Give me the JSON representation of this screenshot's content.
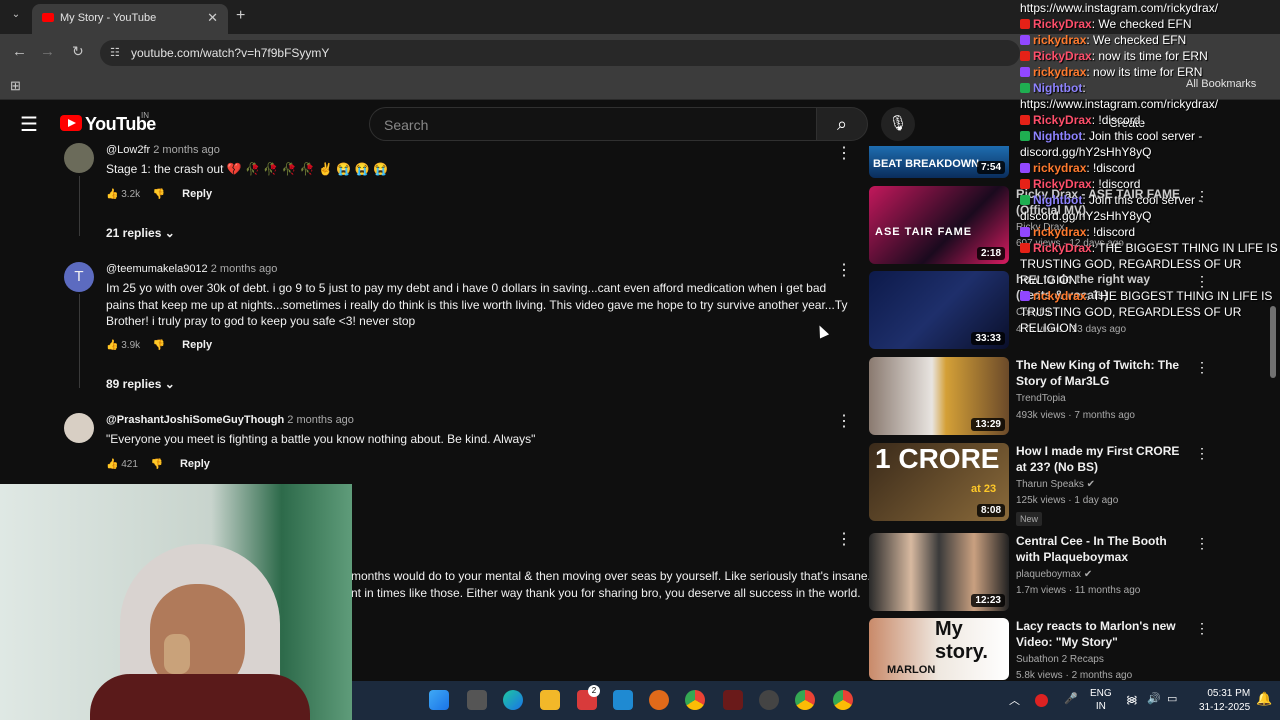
{
  "browser": {
    "tab_title": "My Story - YouTube",
    "url": "youtube.com/watch?v=h7f9bFSyymY",
    "all_bookmarks": "All Bookmarks",
    "new_tab": "+",
    "close": "✕"
  },
  "header": {
    "logo_word": "YouTube",
    "country": "IN",
    "search_placeholder": "Search",
    "create_label": "Create"
  },
  "comments": [
    {
      "author": "@Low2fr",
      "age": "2 months ago",
      "text": "Stage 1: the crash out 💔 🥀 🥀 🥀 🥀 ✌️ 😭 😭 😭",
      "likes": "3.2k",
      "reply": "Reply",
      "replies": "21 replies"
    },
    {
      "author": "@teemumakela9012",
      "age": "2 months ago",
      "avatar_letter": "T",
      "text": "Im 25 yo with over 30k of debt. i go 9 to 5 just to pay my debt and i have 0 dollars in saving...cant even afford medication when i get bad pains that keep me up at nights...sometimes i really do think is this live worth living. This video gave me hope to try survive another year...Ty Brother! i truly pray to god to keep you safe <3! never stop",
      "likes": "3.9k",
      "reply": "Reply",
      "replies": "89 replies"
    },
    {
      "author": "@PrashantJoshiSomeGuyThough",
      "age": "2 months ago",
      "text": "\"Everyone you meet is fighting a battle you know nothing about. Be kind. Always\"",
      "likes": "421",
      "reply": "Reply"
    },
    {
      "text_line1": "months would do to your mental & then moving over seas by yourself. Like seriously that's insane.",
      "text_line2": "nt in times like those. Either way thank you for sharing bro, you deserve all success in the world."
    }
  ],
  "sidebar": [
    {
      "title": "",
      "duration": "7:54",
      "thumb_text": "BEAT BREAKDOWN"
    },
    {
      "title": "Ricky Drax - ASE TAIR FAME (Official MV)",
      "channel": "Ricky Drax",
      "meta": "607 views · 12 days ago",
      "duration": "2:18",
      "thumb_text": "ASE TAIR FAME"
    },
    {
      "title": "how to do the right way (beats & vocals)",
      "channel": "Codyfel",
      "meta": "4.7k views · 13 days ago",
      "duration": "33:33"
    },
    {
      "title": "The New King of Twitch: The Story of Mar3LG",
      "channel": "TrendTopia",
      "meta": "493k views · 7 months ago",
      "duration": "13:29"
    },
    {
      "title": "How I made my First CRORE at 23? (No BS)",
      "channel": "Tharun Speaks",
      "meta": "125k views · 1 day ago",
      "duration": "8:08",
      "badge": "New",
      "thumb_text": "1 CRORE",
      "thumb_sub": "at 23"
    },
    {
      "title": "Central Cee - In The Booth with Plaqueboymax",
      "channel": "plaqueboymax",
      "meta": "1.7m views · 11 months ago",
      "duration": "12:23"
    },
    {
      "title": "Lacy reacts to Marlon's new Video: \"My Story\"",
      "channel": "Subathon 2 Recaps",
      "meta": "5.8k views · 2 months ago",
      "thumb_text": "My story.",
      "thumb_sub": "MARLON"
    }
  ],
  "chat": [
    {
      "text": "https://www.instagram.com/rickydrax/",
      "user": "",
      "color": "#ffffff"
    },
    {
      "user": "RickyDrax",
      "text": ": We checked EFN",
      "color": "#ff4f6b",
      "badge": "#e62117"
    },
    {
      "user": "rickydrax",
      "text": ": We checked EFN",
      "color": "#ff7a2e",
      "badge": "#9147ff"
    },
    {
      "user": "RickyDrax",
      "text": ": now its time for ERN",
      "color": "#ff4f6b",
      "badge": "#e62117"
    },
    {
      "user": "rickydrax",
      "text": ": now its time for ERN",
      "color": "#ff7a2e",
      "badge": "#9147ff"
    },
    {
      "user": "Nightbot",
      "text": ":",
      "color": "#8e83ff",
      "badge": "#1fae51"
    },
    {
      "user": "",
      "text": "https://www.instagram.com/rickydrax/",
      "color": "#ffffff"
    },
    {
      "user": "RickyDrax",
      "text": ": !discord",
      "color": "#ff4f6b",
      "badge": "#e62117"
    },
    {
      "user": "Nightbot",
      "text": ": Join this cool server -",
      "color": "#8e83ff",
      "badge": "#1fae51"
    },
    {
      "user": "",
      "text": "discord.gg/hY2sHhY8yQ",
      "color": "#ffffff"
    },
    {
      "user": "rickydrax",
      "text": ": !discord",
      "color": "#ff7a2e",
      "badge": "#9147ff"
    },
    {
      "user": "RickyDrax",
      "text": ": !discord",
      "color": "#ff4f6b",
      "badge": "#e62117"
    },
    {
      "user": "Nightbot",
      "text": ": Join this cool server -",
      "color": "#8e83ff",
      "badge": "#1fae51"
    },
    {
      "user": "",
      "text": "discord.gg/hY2sHhY8yQ",
      "color": "#ffffff"
    },
    {
      "user": "rickydrax",
      "text": ": !discord",
      "color": "#ff7a2e",
      "badge": "#9147ff"
    },
    {
      "user": "RickyDrax",
      "text": ": THE BIGGEST THING IN LIFE IS",
      "color": "#ff4f6b",
      "badge": "#e62117"
    },
    {
      "user": "",
      "text": "TRUSTING GOD, REGARDLESS OF UR",
      "color": "#ffffff"
    },
    {
      "user": "",
      "text": "RELIGION",
      "color": "#ffffff"
    },
    {
      "user": "rickydrax",
      "text": ": THE BIGGEST THING IN LIFE IS",
      "color": "#ff7a2e",
      "badge": "#9147ff"
    },
    {
      "user": "",
      "text": "TRUSTING GOD, REGARDLESS OF UR",
      "color": "#ffffff"
    },
    {
      "user": "",
      "text": "RELIGION",
      "color": "#ffffff"
    }
  ],
  "taskbar": {
    "lang1": "ENG",
    "lang2": "IN",
    "time": "05:31 PM",
    "date": "31-12-2025",
    "notif_count": "2"
  }
}
